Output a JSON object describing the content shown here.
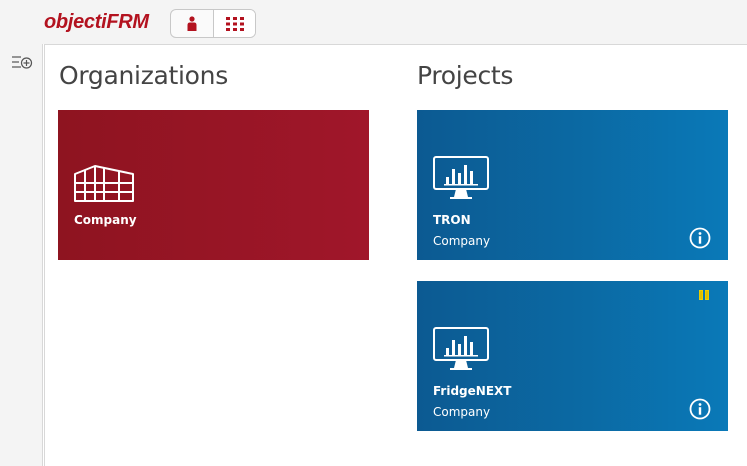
{
  "app": {
    "logo_main": "objecti",
    "logo_accent": "FRM"
  },
  "colors": {
    "brand_red": "#b3121f",
    "org_tile": "#9a1526",
    "project_tile": "#0b6aa4",
    "pin_yellow": "#f0d000"
  },
  "header": {
    "toggle": {
      "person_icon": "person-icon",
      "grid_icon": "grid-icon"
    }
  },
  "rail": {
    "icon": "menu-add-icon"
  },
  "organizations": {
    "title": "Organizations",
    "tiles": [
      {
        "name": "Company",
        "icon": "building-icon"
      }
    ]
  },
  "projects": {
    "title": "Projects",
    "tiles": [
      {
        "name": "TRON",
        "org": "Company",
        "icon": "monitor-chart-icon",
        "pinned": false
      },
      {
        "name": "FridgeNEXT",
        "org": "Company",
        "icon": "monitor-chart-icon",
        "pinned": true
      }
    ]
  }
}
